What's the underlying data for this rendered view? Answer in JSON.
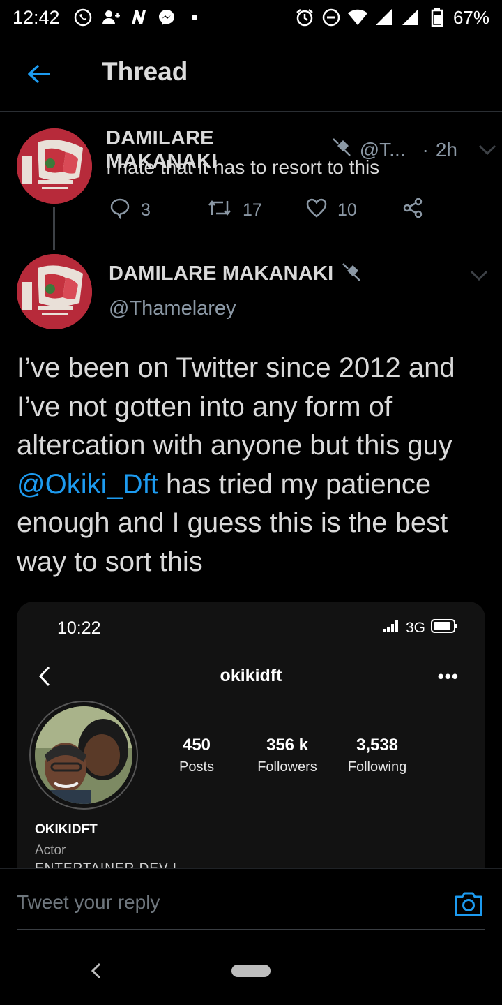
{
  "status_bar": {
    "time": "12:42",
    "battery": "67%",
    "left_icons": [
      "whatsapp-icon",
      "add-user-icon",
      "n-app-icon",
      "messenger-icon",
      "dot-icon"
    ],
    "right_icons": [
      "alarm-icon",
      "do-not-disturb-icon",
      "wifi-icon",
      "signal-icon",
      "signal-icon",
      "battery-icon"
    ]
  },
  "header": {
    "title": "Thread"
  },
  "tweet1": {
    "name": "DAMILARE MAKANAKI",
    "handle": "@T...",
    "separator": "·",
    "time": "2h",
    "text": "I hate that it has to resort to this",
    "replies": "3",
    "retweets": "17",
    "likes": "10"
  },
  "tweet2": {
    "name": "DAMILARE MAKANAKI",
    "handle": "@Thamelarey",
    "text_before": "I’ve been on Twitter since 2012 and I’ve not gotten into any form of altercation with anyone but this guy ",
    "mention": "@Okiki_Dft",
    "text_after": " has tried my patience enough and I guess this is the best way to sort this"
  },
  "embedded_screenshot": {
    "time": "10:22",
    "network": "3G",
    "username": "okikidft",
    "more": "•••",
    "posts_count": "450",
    "posts_label": "Posts",
    "followers_count": "356 k",
    "followers_label": "Followers",
    "following_count": "3,538",
    "following_label": "Following",
    "profile_name": "OKIKIDFT",
    "profile_category": "Actor",
    "profile_bio_partial": "ENTERTAINER DEV |"
  },
  "reply": {
    "placeholder": "Tweet your reply"
  },
  "colors": {
    "background": "#000000",
    "accent": "#1d9bf0",
    "muted": "#8b98a5"
  }
}
